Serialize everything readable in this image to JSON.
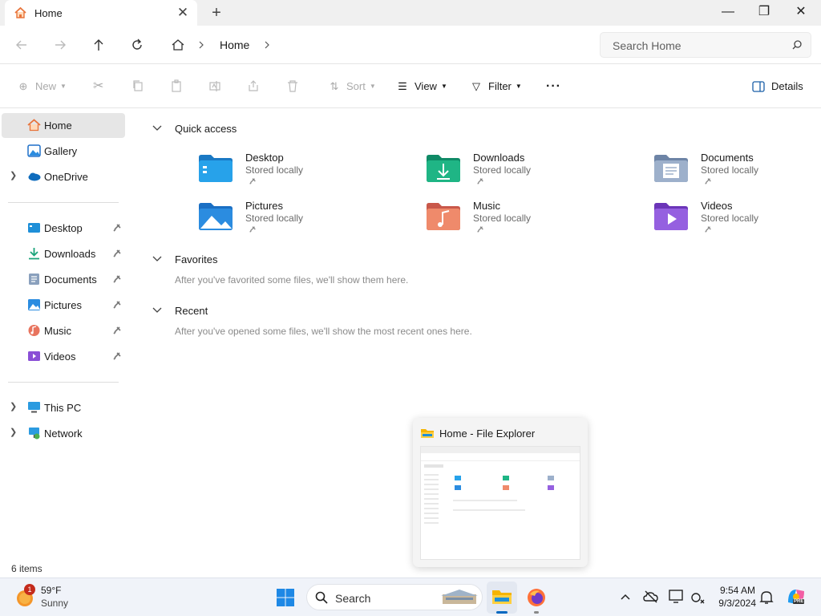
{
  "window": {
    "tab_title": "Home",
    "tab_close": "✕",
    "new_tab": "+",
    "minimize": "—",
    "maximize": "❐",
    "close": "✕"
  },
  "address": {
    "breadcrumb": "Home",
    "search_placeholder": "Search Home"
  },
  "toolbar": {
    "new": "New",
    "sort": "Sort",
    "view": "View",
    "filter": "Filter",
    "more": "···",
    "details": "Details"
  },
  "sidebar": {
    "top": [
      {
        "label": "Home",
        "icon": "home-icon"
      },
      {
        "label": "Gallery",
        "icon": "gallery-icon"
      },
      {
        "label": "OneDrive",
        "icon": "onedrive-icon"
      }
    ],
    "pinned": [
      {
        "label": "Desktop",
        "icon": "desktop-folder-icon"
      },
      {
        "label": "Downloads",
        "icon": "downloads-icon"
      },
      {
        "label": "Documents",
        "icon": "documents-icon"
      },
      {
        "label": "Pictures",
        "icon": "pictures-icon"
      },
      {
        "label": "Music",
        "icon": "music-icon"
      },
      {
        "label": "Videos",
        "icon": "videos-icon"
      }
    ],
    "bottom": [
      {
        "label": "This PC",
        "icon": "this-pc-icon"
      },
      {
        "label": "Network",
        "icon": "network-icon"
      }
    ]
  },
  "main": {
    "quick_access": {
      "title": "Quick access",
      "items": [
        {
          "name": "Desktop",
          "sub": "Stored locally",
          "icon": "desktop-folder-icon"
        },
        {
          "name": "Downloads",
          "sub": "Stored locally",
          "icon": "downloads-folder-icon"
        },
        {
          "name": "Documents",
          "sub": "Stored locally",
          "icon": "documents-folder-icon"
        },
        {
          "name": "Pictures",
          "sub": "Stored locally",
          "icon": "pictures-folder-icon"
        },
        {
          "name": "Music",
          "sub": "Stored locally",
          "icon": "music-folder-icon"
        },
        {
          "name": "Videos",
          "sub": "Stored locally",
          "icon": "videos-folder-icon"
        }
      ]
    },
    "favorites": {
      "title": "Favorites",
      "empty": "After you've favorited some files, we'll show them here."
    },
    "recent": {
      "title": "Recent",
      "empty": "After you've opened some files, we'll show the most recent ones here."
    }
  },
  "status": {
    "items": "6 items"
  },
  "thumbnail": {
    "title": "Home - File Explorer"
  },
  "taskbar": {
    "weather_temp": "59°F",
    "weather_condition": "Sunny",
    "weather_badge": "1",
    "search_placeholder": "Search",
    "time": "9:54 AM",
    "date": "9/3/2024",
    "copilot_badge": "PRE"
  },
  "colors": {
    "accent": "#0067c0",
    "folder_desktop": "#1e8fd8",
    "folder_downloads": "#1aa37a",
    "folder_documents": "#8aa0bd",
    "folder_pictures": "#2b8ce0",
    "folder_music": "#e8745e",
    "folder_videos": "#8a4fd6"
  }
}
